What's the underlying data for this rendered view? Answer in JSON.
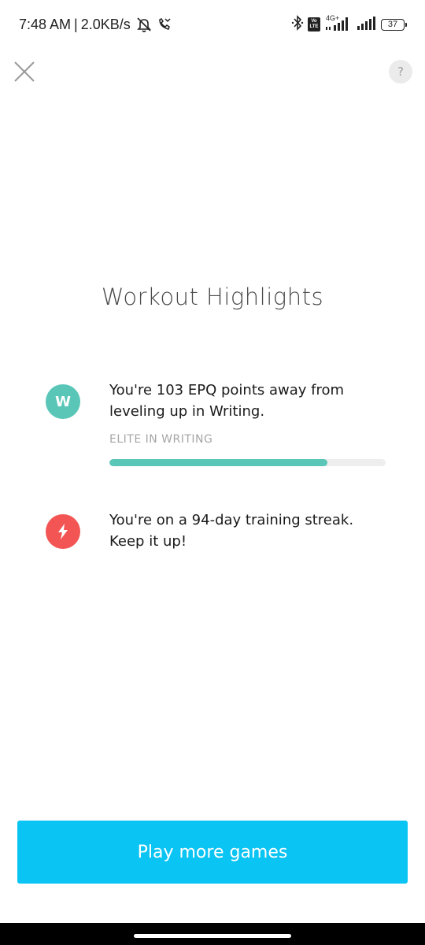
{
  "status_bar": {
    "time": "7:48 AM",
    "separator": "|",
    "net_speed": "2.0KB/s",
    "icons": [
      "mute-icon",
      "missed-call-icon",
      "bluetooth-icon",
      "volte-icon",
      "signal-4g-icon",
      "signal-icon",
      "battery-icon"
    ],
    "volte_top": "Vo",
    "volte_bottom": "LTE",
    "network_type": "4G+",
    "battery": "37"
  },
  "header": {
    "close_icon": "close-icon",
    "help_label": "?"
  },
  "title": "Workout Highlights",
  "highlights": [
    {
      "icon": "writing-badge-icon",
      "badge_letter": "W",
      "color": "#5ac6b8",
      "line1": "You're 103 EPQ points away from",
      "line2": "leveling up in Writing.",
      "level_label": "ELITE IN WRITING",
      "progress": 0.79
    },
    {
      "icon": "lightning-icon",
      "color": "#f25553",
      "line1": "You're on a 94-day training streak.",
      "line2": "Keep it up!"
    }
  ],
  "cta": {
    "label": "Play more games",
    "color": "#0ac4f4"
  }
}
